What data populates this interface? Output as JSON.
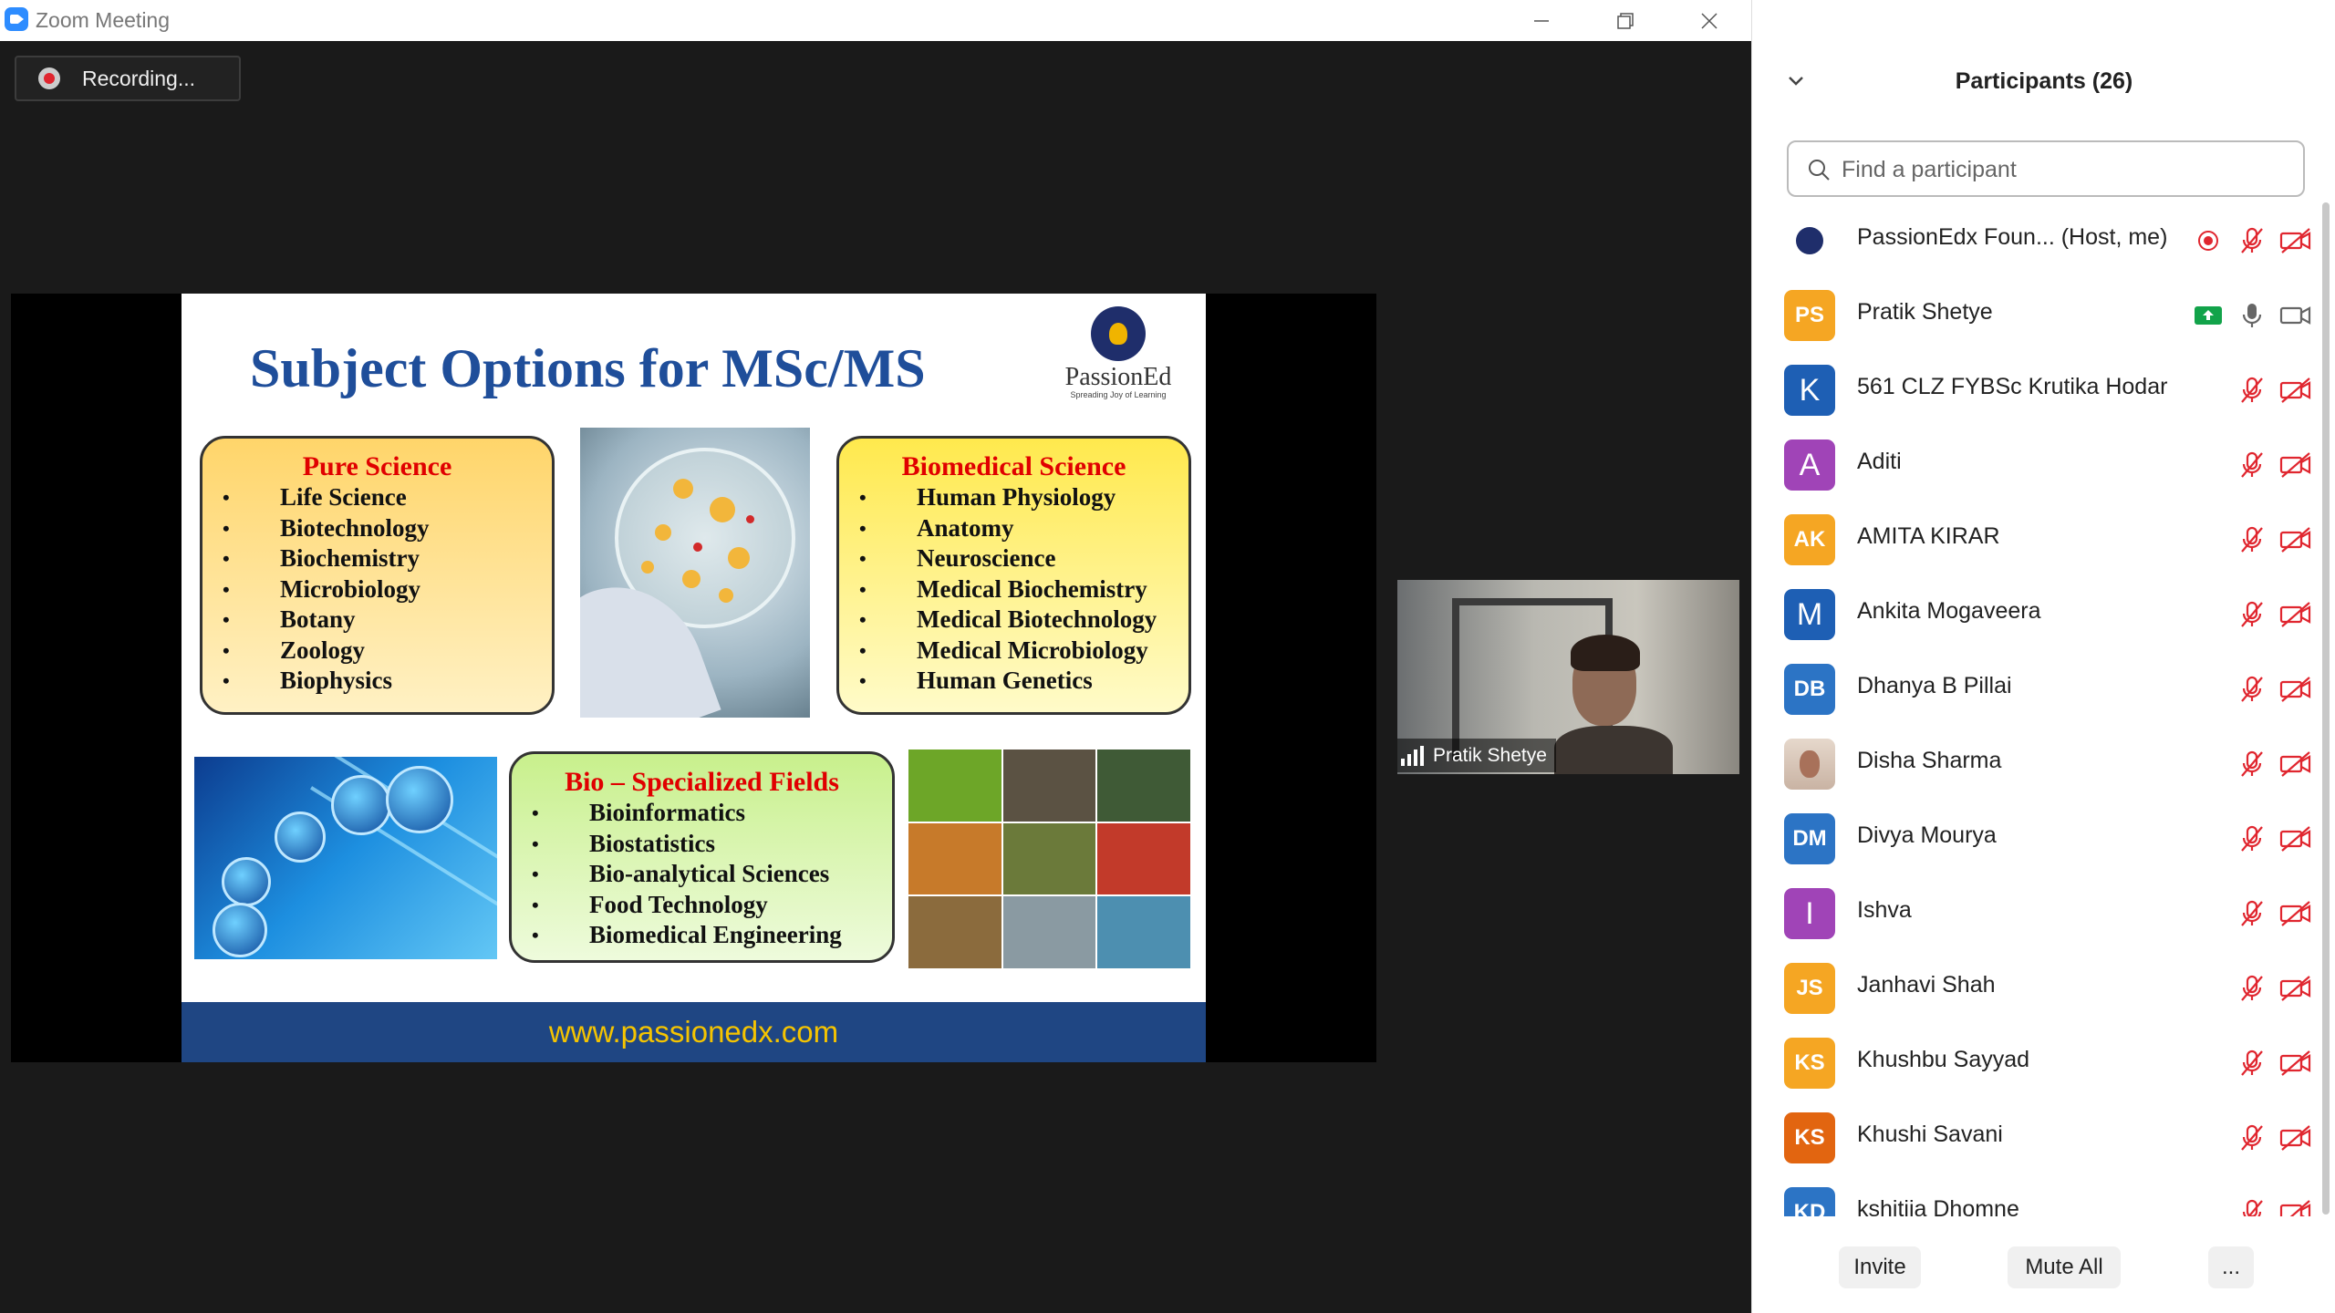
{
  "window": {
    "title": "Zoom Meeting"
  },
  "meeting": {
    "recording_label": "Recording...",
    "slide": {
      "title": "Subject Options for MSc/MS",
      "logo_brand": "PassionEd",
      "logo_tagline": "Spreading Joy of Learning",
      "pure_science": {
        "heading": "Pure Science",
        "items": [
          "Life Science",
          "Biotechnology",
          "Biochemistry",
          "Microbiology",
          "Botany",
          "Zoology",
          "Biophysics"
        ]
      },
      "biomedical_science": {
        "heading": "Biomedical Science",
        "items": [
          "Human Physiology",
          "Anatomy",
          "Neuroscience",
          "Medical Biochemistry",
          "Medical Biotechnology",
          "Medical Microbiology",
          "Human Genetics"
        ]
      },
      "bio_specialized": {
        "heading": "Bio – Specialized Fields",
        "items": [
          "Bioinformatics",
          "Biostatistics",
          "Bio-analytical Sciences",
          "Food Technology",
          "Biomedical Engineering"
        ]
      },
      "footer_url": "www.passionedx.com"
    },
    "video_tile": {
      "name": "Pratik Shetye"
    }
  },
  "participants_panel": {
    "title": "Participants (26)",
    "search_placeholder": "Find a participant",
    "participants": [
      {
        "initials": "",
        "name": "PassionEdx Foun...  (Host, me)",
        "color": "#ffffff",
        "avatar": "logo",
        "recording": true,
        "muted": true,
        "video_off": true
      },
      {
        "initials": "PS",
        "name": "Pratik Shetye",
        "color": "#f5a623",
        "screen_share": true,
        "muted": false,
        "video_off": false
      },
      {
        "initials": "K",
        "name": "561 CLZ FYBSc Krutika Hodar",
        "color": "#1e5fb4",
        "muted": true,
        "video_off": true
      },
      {
        "initials": "A",
        "name": "Aditi",
        "color": "#a044b7",
        "muted": true,
        "video_off": true
      },
      {
        "initials": "AK",
        "name": "AMITA KIRAR",
        "color": "#f5a623",
        "muted": true,
        "video_off": true
      },
      {
        "initials": "M",
        "name": "Ankita Mogaveera",
        "color": "#1e5fb4",
        "muted": true,
        "video_off": true
      },
      {
        "initials": "DB",
        "name": "Dhanya B Pillai",
        "color": "#2c74c5",
        "muted": true,
        "video_off": true
      },
      {
        "initials": "",
        "name": "Disha Sharma",
        "color": "#d9c4b4",
        "avatar": "photo",
        "muted": true,
        "video_off": true
      },
      {
        "initials": "DM",
        "name": "Divya Mourya",
        "color": "#2c74c5",
        "muted": true,
        "video_off": true
      },
      {
        "initials": "I",
        "name": "Ishva",
        "color": "#a044b7",
        "muted": true,
        "video_off": true
      },
      {
        "initials": "JS",
        "name": "Janhavi Shah",
        "color": "#f5a623",
        "muted": true,
        "video_off": true
      },
      {
        "initials": "KS",
        "name": "Khushbu Sayyad",
        "color": "#f5a623",
        "muted": true,
        "video_off": true
      },
      {
        "initials": "KS",
        "name": "Khushi Savani",
        "color": "#e26510",
        "muted": true,
        "video_off": true
      },
      {
        "initials": "KD",
        "name": "kshitija Dhomne",
        "color": "#2c74c5",
        "muted": true,
        "video_off": true
      }
    ],
    "buttons": {
      "invite": "Invite",
      "mute_all": "Mute All",
      "more": "..."
    }
  },
  "colors": {
    "accent": "#2d8cff",
    "muted_icon": "#e0262f",
    "share_green": "#12a34a",
    "slide_title": "#1f4e9a",
    "slide_footer": "#1f4683"
  }
}
